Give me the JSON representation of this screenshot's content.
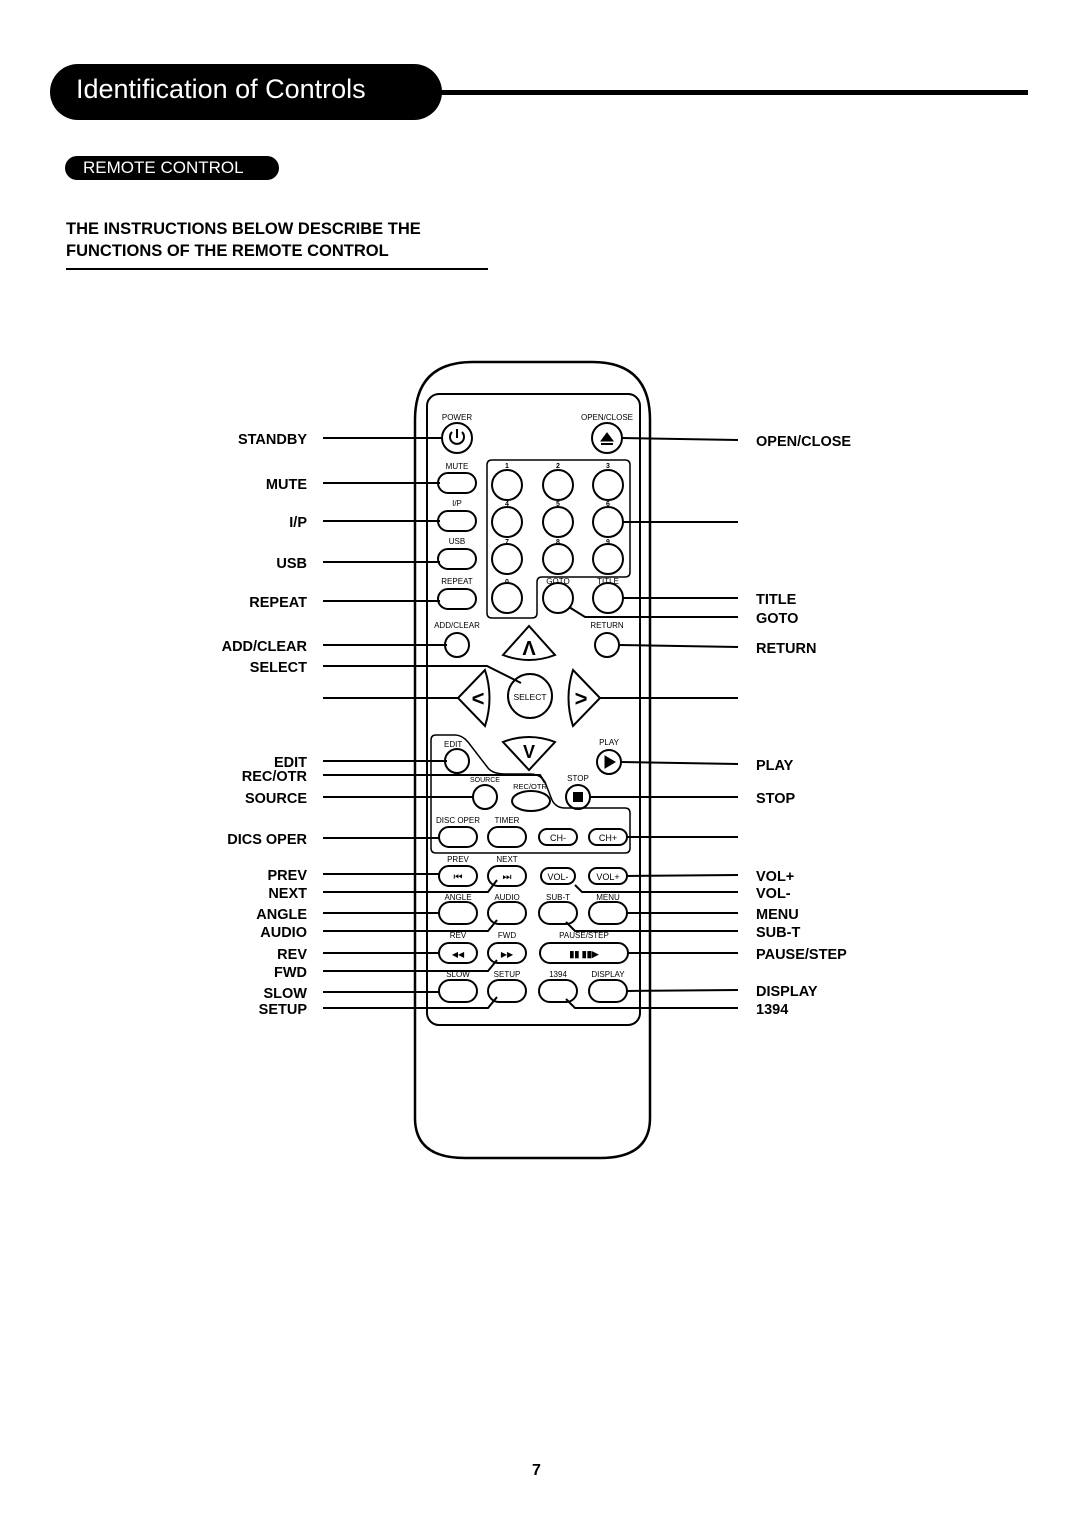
{
  "header": {
    "title": "Identification of Controls",
    "section": "REMOTE CONTROL",
    "intro_line1": "THE INSTRUCTIONS BELOW DESCRIBE THE",
    "intro_line2": "FUNCTIONS OF THE REMOTE CONTROL"
  },
  "callouts_left": [
    "STANDBY",
    "MUTE",
    "I/P",
    "USB",
    "REPEAT",
    "ADD/CLEAR",
    "SELECT",
    "EDIT",
    "REC/OTR",
    "SOURCE",
    "DICS OPER",
    "PREV",
    "NEXT",
    "ANGLE",
    "AUDIO",
    "REV",
    "FWD",
    "SLOW",
    "SETUP"
  ],
  "callouts_right": [
    "OPEN/CLOSE",
    "TITLE",
    "GOTO",
    "RETURN",
    "PLAY",
    "STOP",
    "VOL+",
    "VOL-",
    "MENU",
    "SUB-T",
    "PAUSE/STEP",
    "DISPLAY",
    "1394"
  ],
  "remote_labels": {
    "power": "POWER",
    "open_close": "OPEN/CLOSE",
    "mute": "MUTE",
    "ip": "I/P",
    "usb": "USB",
    "repeat": "REPEAT",
    "digits": [
      "1",
      "2",
      "3",
      "4",
      "5",
      "6",
      "7",
      "8",
      "9",
      "0"
    ],
    "goto": "GOTO",
    "title": "TITLE",
    "add_clear": "ADD/CLEAR",
    "return": "RETURN",
    "select": "SELECT",
    "up": "Λ",
    "down": "V",
    "left": "<",
    "right": ">",
    "edit": "EDIT",
    "play": "PLAY",
    "source": "SOURCE",
    "rec_otr": "REC/OTR",
    "stop": "STOP",
    "disc_oper": "DISC OPER",
    "timer": "TIMER",
    "ch_minus": "CH-",
    "ch_plus": "CH+",
    "prev": "PREV",
    "next": "NEXT",
    "vol_minus": "VOL-",
    "vol_plus": "VOL+",
    "angle": "ANGLE",
    "audio": "AUDIO",
    "sub_t": "SUB-T",
    "menu": "MENU",
    "rev": "REV",
    "fwd": "FWD",
    "pause_step": "PAUSE/STEP",
    "slow": "SLOW",
    "setup": "SETUP",
    "n1394": "1394",
    "display": "DISPLAY"
  },
  "icons": {
    "power": "power-icon",
    "eject": "eject-icon",
    "play": "play-icon",
    "stop": "stop-icon",
    "prev": "skip-back-icon",
    "next": "skip-forward-icon",
    "rev": "rewind-icon",
    "fwd": "fast-forward-icon",
    "pause_step": "pause-step-icon"
  },
  "page_number": "7"
}
